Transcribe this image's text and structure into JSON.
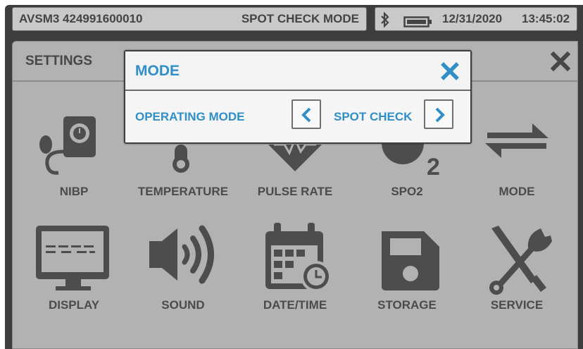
{
  "status_bar": {
    "device_id": "AVSM3 424991600010",
    "mode": "SPOT CHECK MODE",
    "date": "12/31/2020",
    "time": "13:45:02",
    "icons": [
      "bluetooth-icon",
      "battery-icon"
    ]
  },
  "settings": {
    "title": "SETTINGS",
    "tiles": [
      {
        "label": "NIBP",
        "icon": "blood-pressure-cuff-icon"
      },
      {
        "label": "TEMPERATURE",
        "icon": "thermometer-icon"
      },
      {
        "label": "PULSE RATE",
        "icon": "heart-pulse-icon"
      },
      {
        "label": "SPO2",
        "icon": "o2-icon"
      },
      {
        "label": "MODE",
        "icon": "swap-arrows-icon"
      },
      {
        "label": "DISPLAY",
        "icon": "monitor-icon"
      },
      {
        "label": "SOUND",
        "icon": "speaker-icon"
      },
      {
        "label": "DATE/TIME",
        "icon": "calendar-clock-icon"
      },
      {
        "label": "STORAGE",
        "icon": "floppy-disk-icon"
      },
      {
        "label": "SERVICE",
        "icon": "wrench-screwdriver-icon"
      }
    ]
  },
  "modal": {
    "title": "MODE",
    "operating_mode_label": "OPERATING MODE",
    "operating_mode_value": "SPOT CHECK"
  },
  "colors": {
    "accent_blue": "#2f8fc6",
    "panel_gray": "#b2b2b2",
    "icon_gray": "#4d4d4d",
    "frame_dark": "#3d3d3d"
  }
}
